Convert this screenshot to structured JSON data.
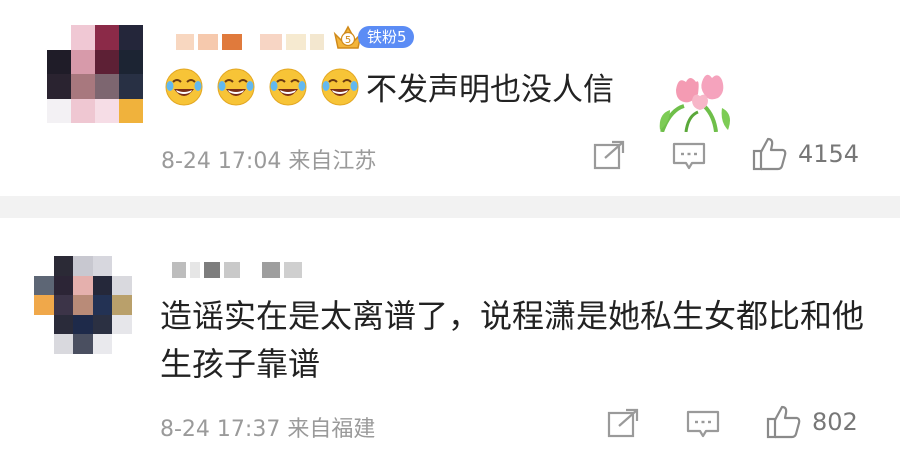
{
  "comments": [
    {
      "badge_label": "铁粉5",
      "text": "不发声明也没人信",
      "emoji_icon": "crying-laughing-face",
      "sticker_icon": "tulip-sticker",
      "timestamp": "8-24 17:04",
      "location": "来自江苏",
      "likes": "4154"
    },
    {
      "text": "造谣实在是太离谱了，说程潇是她私生女都比和他生孩子靠谱",
      "timestamp": "8-24 17:37",
      "location": "来自福建",
      "likes": "802"
    }
  ],
  "icons": {
    "share": "share-icon",
    "comment": "comment-icon",
    "like": "thumbs-up-icon"
  },
  "colors": {
    "badge_blue": "#5b8cf5",
    "text": "#222222",
    "meta_gray": "#9a9a9a",
    "divider_gray": "#f2f2f2"
  }
}
